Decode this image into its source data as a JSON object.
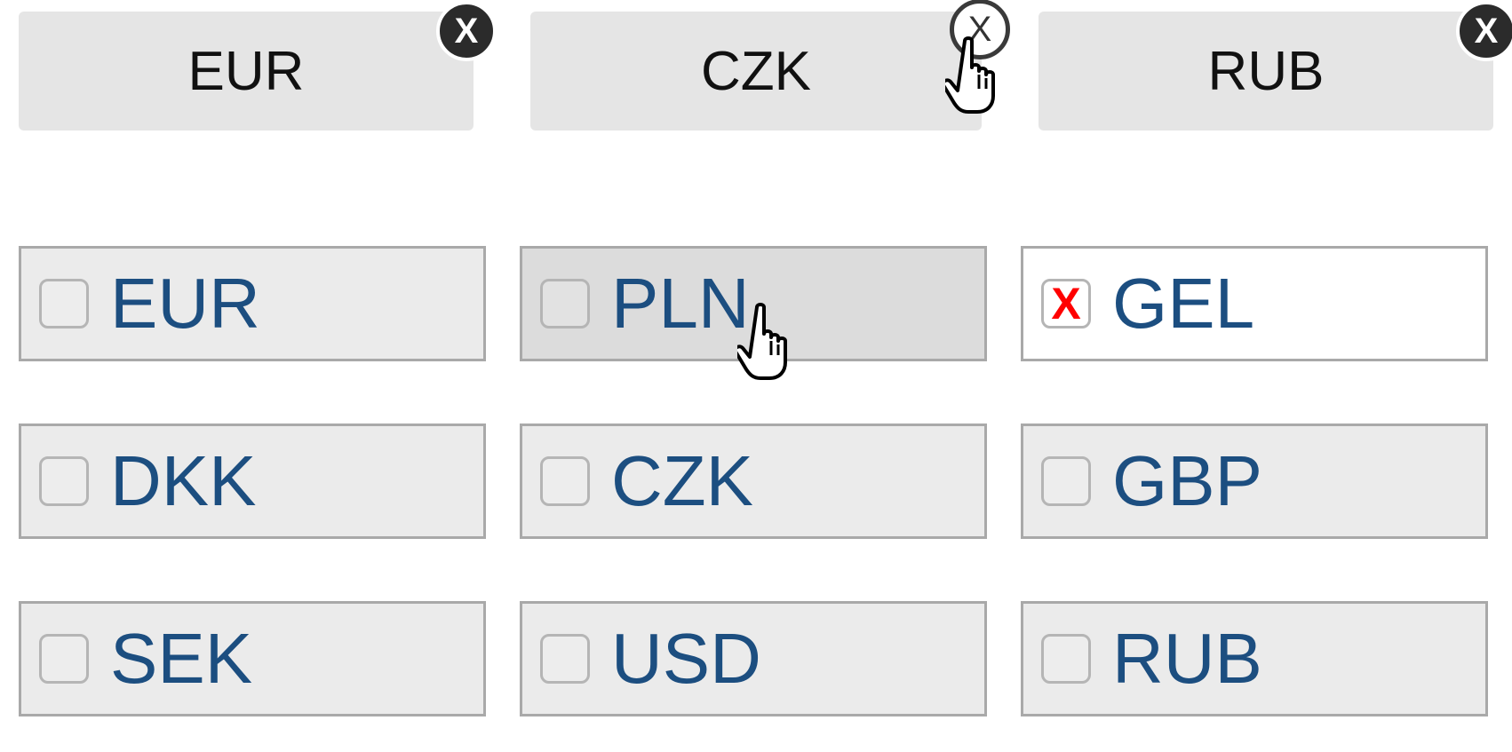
{
  "selected_chips": [
    {
      "label": "EUR",
      "remove": "X"
    },
    {
      "label": "CZK",
      "remove": "X"
    },
    {
      "label": "RUB",
      "remove": "X"
    }
  ],
  "options": [
    {
      "label": "EUR",
      "checked": false,
      "mark": ""
    },
    {
      "label": "PLN",
      "checked": false,
      "mark": ""
    },
    {
      "label": "GEL",
      "checked": true,
      "mark": "X"
    },
    {
      "label": "DKK",
      "checked": false,
      "mark": ""
    },
    {
      "label": "CZK",
      "checked": false,
      "mark": ""
    },
    {
      "label": "GBP",
      "checked": false,
      "mark": ""
    },
    {
      "label": "SEK",
      "checked": false,
      "mark": ""
    },
    {
      "label": "USD",
      "checked": false,
      "mark": ""
    },
    {
      "label": "RUB",
      "checked": false,
      "mark": ""
    }
  ],
  "colors": {
    "label_text": "#1c4e80",
    "check_mark": "#ff0000",
    "chip_bg": "#e5e5e5",
    "option_bg": "#ebebeb",
    "option_hover_bg": "#dcdcdc"
  },
  "cursor_icon": "hand-pointer-icon"
}
